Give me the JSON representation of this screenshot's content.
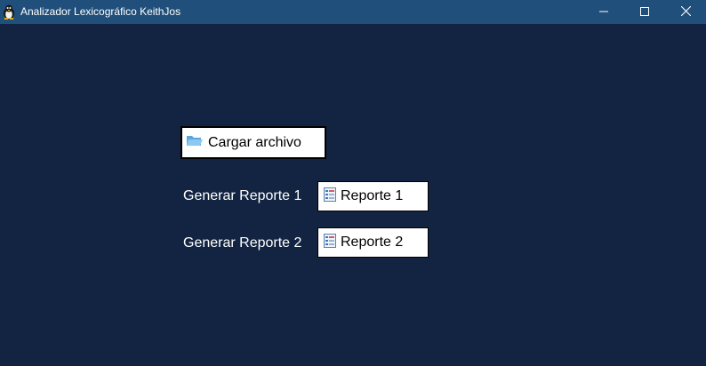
{
  "window": {
    "title": "Analizador Lexicográfico KeithJos",
    "app_icon": "tux-penguin-icon",
    "controls": [
      "minimize-icon",
      "maximize-icon",
      "close-icon"
    ]
  },
  "colors": {
    "background": "#132442",
    "titlebar": "#1f4f7a",
    "button_bg": "#ffffff",
    "label_text": "#ffffff"
  },
  "main": {
    "load_button": {
      "label": "Cargar archivo",
      "icon": "folder-open-icon"
    },
    "reports": [
      {
        "label": "Generar Reporte 1",
        "button_label": "Reporte 1",
        "icon": "report-icon"
      },
      {
        "label": "Generar Reporte 2",
        "button_label": "Reporte 2",
        "icon": "report-icon"
      }
    ]
  }
}
